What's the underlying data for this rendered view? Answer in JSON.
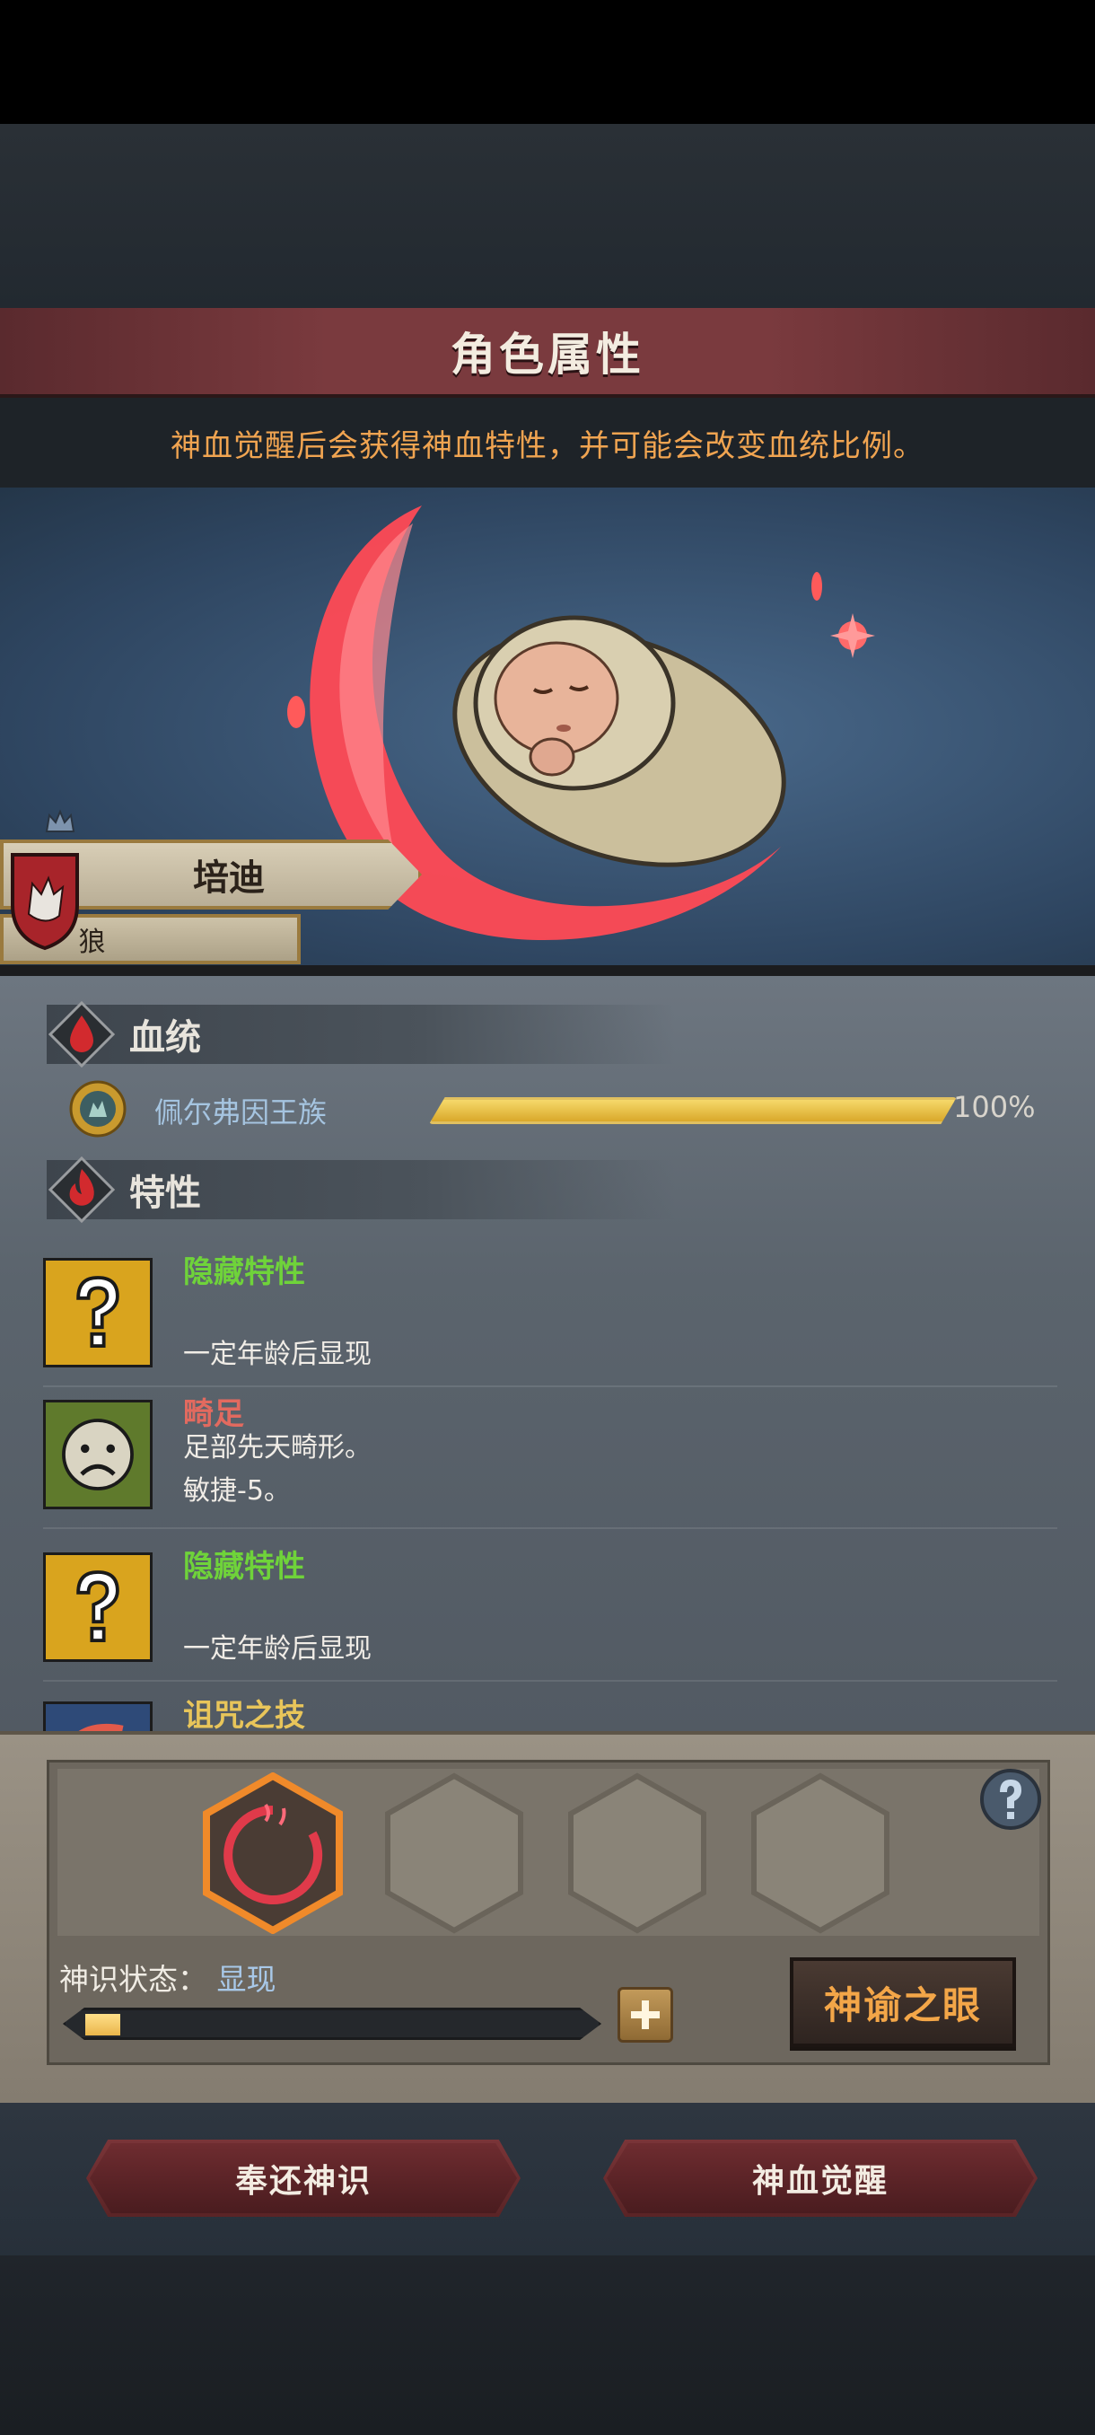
{
  "header": {
    "title": "角色属性",
    "hint": "神血觉醒后会获得神血特性，并可能会改变血统比例。"
  },
  "character": {
    "name": "培迪",
    "race": "狼",
    "crest_icon": "wolf-shield-icon"
  },
  "lineage_section": {
    "label": "血统",
    "items": [
      {
        "name": "佩尔弗因王族",
        "percent_text": "100%",
        "value": 1.0
      }
    ]
  },
  "traits_section": {
    "label": "特性",
    "items": [
      {
        "title": "隐藏特性",
        "desc1": "",
        "desc2": "一定年龄后显现",
        "icon": "question-mark-icon",
        "color": "green"
      },
      {
        "title": "畸足",
        "desc1": "足部先天畸形。",
        "desc2": "敏捷-5。",
        "icon": "sad-face-icon",
        "color": "red"
      },
      {
        "title": "隐藏特性",
        "desc1": "",
        "desc2": "一定年龄后显现",
        "icon": "question-mark-icon",
        "color": "green"
      },
      {
        "title": "诅咒之技",
        "desc1": "",
        "desc2": "",
        "icon": "curse-swirl-icon",
        "color": "gold"
      }
    ]
  },
  "divine_panel": {
    "state_label": "神识状态：",
    "state_value": "显现",
    "progress": 0.07,
    "oracle_button": "神谕之眼"
  },
  "actions": {
    "return_button": "奉还神识",
    "awaken_button": "神血觉醒"
  },
  "colors": {
    "title_bar": "#7a3a3e",
    "hint_text": "#f0a451",
    "trait_green": "#6fd33a",
    "trait_red": "#e26a5f",
    "lineage_text": "#a5c4e0",
    "oracle_text": "#f3a648"
  }
}
